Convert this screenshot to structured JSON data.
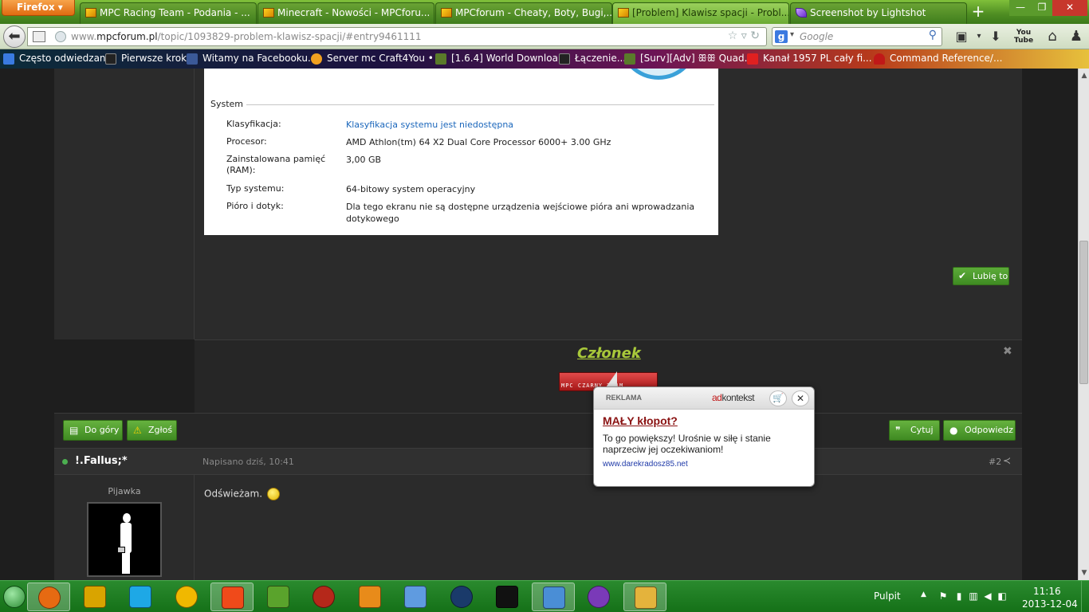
{
  "firefox": {
    "button_label": "Firefox"
  },
  "tabs": [
    {
      "title": "MPC Racing Team - Podania - ..."
    },
    {
      "title": "Minecraft - Nowości - MPCforu..."
    },
    {
      "title": "MPCforum - Cheaty, Boty, Bugi,..."
    },
    {
      "title": "[Problem] Klawisz spacji - Probl..."
    },
    {
      "title": "Screenshot by Lightshot"
    }
  ],
  "address_bar": {
    "url_prefix": "www.",
    "url_host": "mpcforum.pl",
    "url_path": "/topic/1093829-problem-klawisz-spacji/#entry9461111"
  },
  "search_bar": {
    "placeholder": "Google"
  },
  "nav_icons": {
    "youtube_label": "You Tube"
  },
  "bookmarks": [
    {
      "label": "Często odwiedzane"
    },
    {
      "label": "Pierwsze kroki"
    },
    {
      "label": "Witamy na Facebooku..."
    },
    {
      "label": "Server mc Craft4You • ..."
    },
    {
      "label": "[1.6.4] World Downloa..."
    },
    {
      "label": "Łączenie..."
    },
    {
      "label": "[Surv][Adv] ꕥꕥ Quad..."
    },
    {
      "label": "Kanał 1957 PL cały fi..."
    },
    {
      "label": "Command Reference/..."
    }
  ],
  "system_info": {
    "section_title": "System",
    "rows": [
      {
        "label": "Klasyfikacja:",
        "value": "Klasyfikacja systemu jest niedostępna"
      },
      {
        "label": "Procesor:",
        "value": "AMD Athlon(tm) 64 X2 Dual Core Processor 6000+   3.00 GHz"
      },
      {
        "label": "Zainstalowana pamięć (RAM):",
        "value": "3,00 GB"
      },
      {
        "label": "Typ systemu:",
        "value": "64-bitowy system operacyjny"
      },
      {
        "label": "Pióro i dotyk:",
        "value": "Dla tego ekranu nie są dostępne urządzenia wejściowe pióra ani wprowadzania dotykowego"
      }
    ]
  },
  "post1": {
    "like_label": "Lubię to",
    "signature_title": "Członek",
    "signature_colon": ":",
    "signature_banner_text": "MPC CZARNY TEAM"
  },
  "action_bar": {
    "top_label": "Do góry",
    "report_label": "Zgłoś",
    "quote_label": "Cytuj",
    "reply_label": "Odpowiedz"
  },
  "post2": {
    "author": "!.Fallus;*",
    "date": "Napisano dziś, 10:41",
    "number": "#2",
    "rank": "Pijawka",
    "text": "Odświeżam."
  },
  "ad": {
    "label": "REKLAMA",
    "brand_prefix": "ad",
    "brand_suffix": "kontekst",
    "title": "MAŁY kłopot?",
    "body": "To go powiększy! Urośnie w siłę i stanie naprzeciw jej oczekiwaniom!",
    "url": "www.darekradosz85.net"
  },
  "taskbar": {
    "apps": [
      {
        "icon": "firefox-icon",
        "color": "#e66a12",
        "active": true
      },
      {
        "icon": "media-player-icon",
        "color": "#d9a400",
        "active": false
      },
      {
        "icon": "skype-icon",
        "color": "#1ea8e6",
        "active": false
      },
      {
        "icon": "fl-studio-icon",
        "color": "#f0b800",
        "active": false
      },
      {
        "icon": "sun-app-icon",
        "color": "#f04a1a",
        "active": true
      },
      {
        "icon": "minecraft-icon",
        "color": "#5aa32c",
        "active": false
      },
      {
        "icon": "game-character-icon",
        "color": "#b5281a",
        "active": false
      },
      {
        "icon": "video-player-icon",
        "color": "#e88b1a",
        "active": false
      },
      {
        "icon": "paint-icon",
        "color": "#5f9be0",
        "active": false
      },
      {
        "icon": "league-of-legends-icon",
        "color": "#1a3a6a",
        "active": false
      },
      {
        "icon": "command-prompt-icon",
        "color": "#111111",
        "active": false
      },
      {
        "icon": "image-viewer-icon",
        "color": "#4a8ed6",
        "active": true
      },
      {
        "icon": "music-app-icon",
        "color": "#7a3ab8",
        "active": false
      },
      {
        "icon": "folder-icon",
        "color": "#e4b33c",
        "active": true
      }
    ],
    "desktop_label": "Pulpit",
    "time": "11:16",
    "date": "2013-12-04"
  }
}
